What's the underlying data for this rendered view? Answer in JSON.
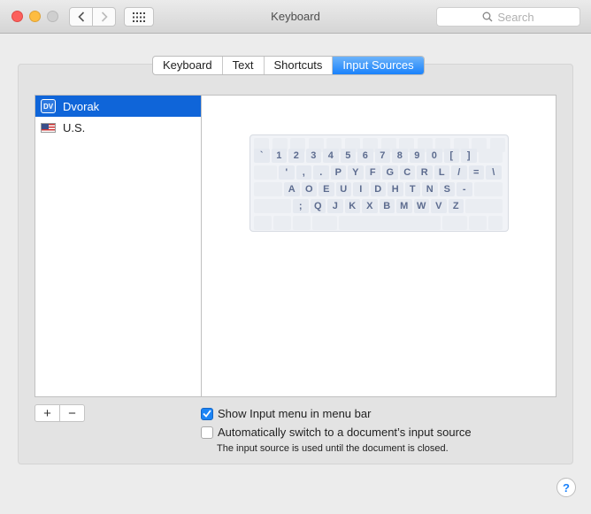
{
  "window": {
    "title": "Keyboard"
  },
  "toolbar": {
    "search_placeholder": "Search"
  },
  "tabs": [
    {
      "label": "Keyboard",
      "active": false
    },
    {
      "label": "Text",
      "active": false
    },
    {
      "label": "Shortcuts",
      "active": false
    },
    {
      "label": "Input Sources",
      "active": true
    }
  ],
  "sources": [
    {
      "label": "Dvorak",
      "badge": "DV",
      "selected": true
    },
    {
      "label": "U.S.",
      "icon": "us-flag-icon",
      "selected": false
    }
  ],
  "keyboard": {
    "rows": [
      [
        "`",
        "1",
        "2",
        "3",
        "4",
        "5",
        "6",
        "7",
        "8",
        "9",
        "0",
        "[",
        "]"
      ],
      [
        "'",
        ",",
        ".",
        "P",
        "Y",
        "F",
        "G",
        "C",
        "R",
        "L",
        "/",
        "=",
        "\\"
      ],
      [
        "A",
        "O",
        "E",
        "U",
        "I",
        "D",
        "H",
        "T",
        "N",
        "S",
        "-"
      ],
      [
        ";",
        "Q",
        "J",
        "K",
        "X",
        "B",
        "M",
        "W",
        "V",
        "Z"
      ]
    ]
  },
  "buttons": {
    "add": "+",
    "remove": "−",
    "help": "?"
  },
  "options": {
    "show_menu": {
      "label": "Show Input menu in menu bar",
      "checked": true
    },
    "auto_switch": {
      "label": "Automatically switch to a document’s input source",
      "checked": false
    },
    "note": "The input source is used until the document is closed."
  },
  "colors": {
    "accent": "#1a82fb",
    "selection": "#0f65d9"
  }
}
